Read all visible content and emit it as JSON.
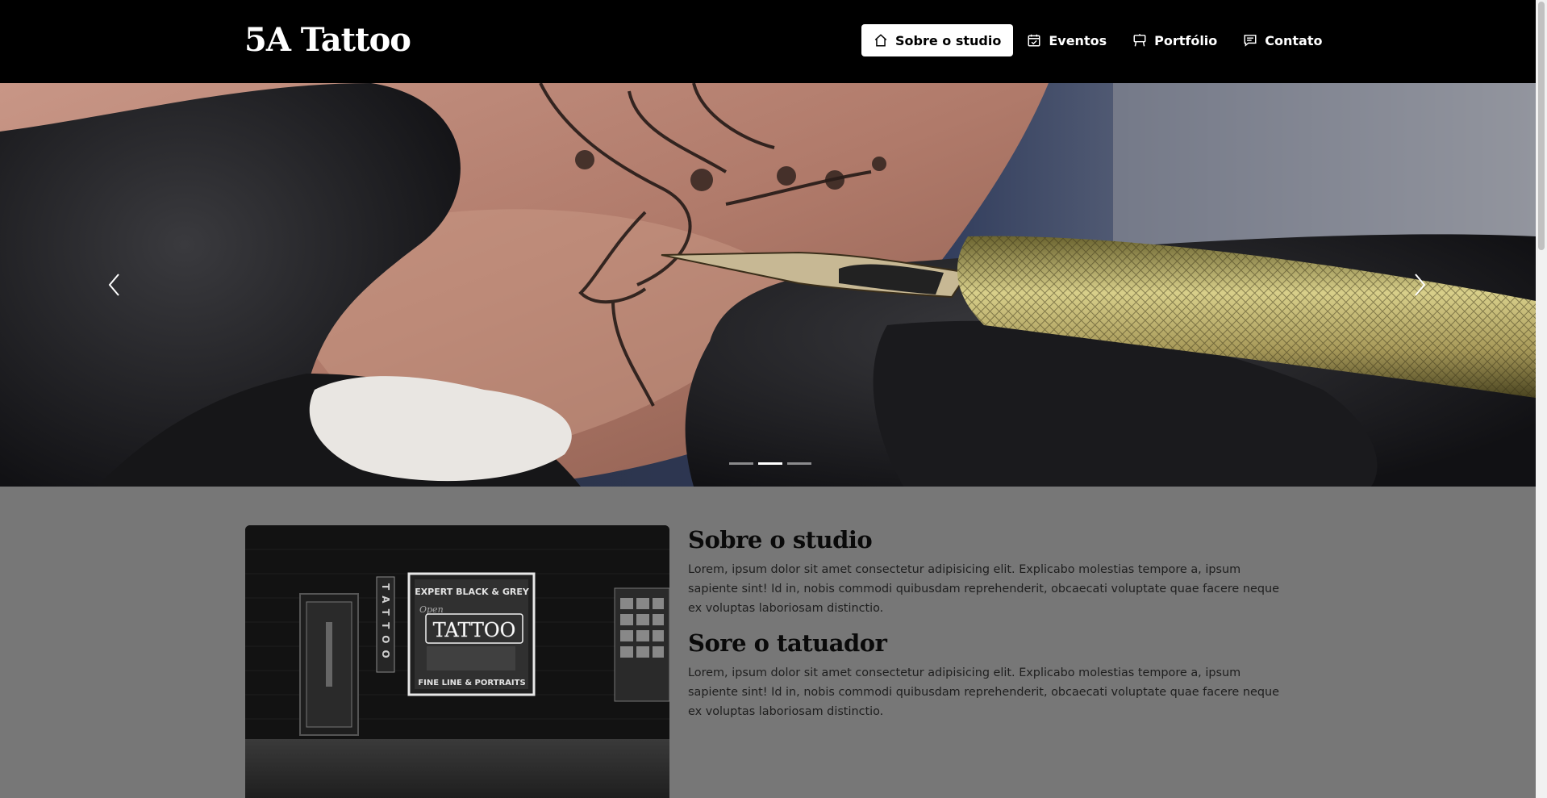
{
  "navbar": {
    "brand": "5A Tattoo",
    "items": [
      {
        "label": "Sobre o studio",
        "icon": "home-icon",
        "active": true
      },
      {
        "label": "Eventos",
        "icon": "calendar-check-icon",
        "active": false
      },
      {
        "label": "Portfólio",
        "icon": "easel-icon",
        "active": false
      },
      {
        "label": "Contato",
        "icon": "chat-icon",
        "active": false
      }
    ]
  },
  "carousel": {
    "prev_icon": "chevron-left-icon",
    "next_icon": "chevron-right-icon",
    "slides": 3,
    "active_slide": 2
  },
  "about": {
    "image_text": {
      "top_sign": "EXPERT BLACK & GREY",
      "neon": "TATTOO",
      "bottom_sign": "FINE LINE & PORTRAITS",
      "open_sign": "Open",
      "side_sign": "TATTOO"
    },
    "studio_title": "Sobre o studio",
    "studio_text": "Lorem, ipsum dolor sit amet consectetur adipisicing elit. Explicabo molestias tempore a, ipsum sapiente sint! Id in, nobis commodi quibusdam reprehenderit, obcaecati voluptate quae facere neque ex voluptas laboriosam distinctio.",
    "artist_title": "Sore o tatuador",
    "artist_text": "Lorem, ipsum dolor sit amet consectetur adipisicing elit. Explicabo molestias tempore a, ipsum sapiente sint! Id in, nobis commodi quibusdam reprehenderit, obcaecati voluptate quae facere neque ex voluptas laboriosam distinctio."
  },
  "colors": {
    "navbar_bg": "#000000",
    "page_bg": "#777777",
    "active_nav_bg": "#ffffff"
  }
}
